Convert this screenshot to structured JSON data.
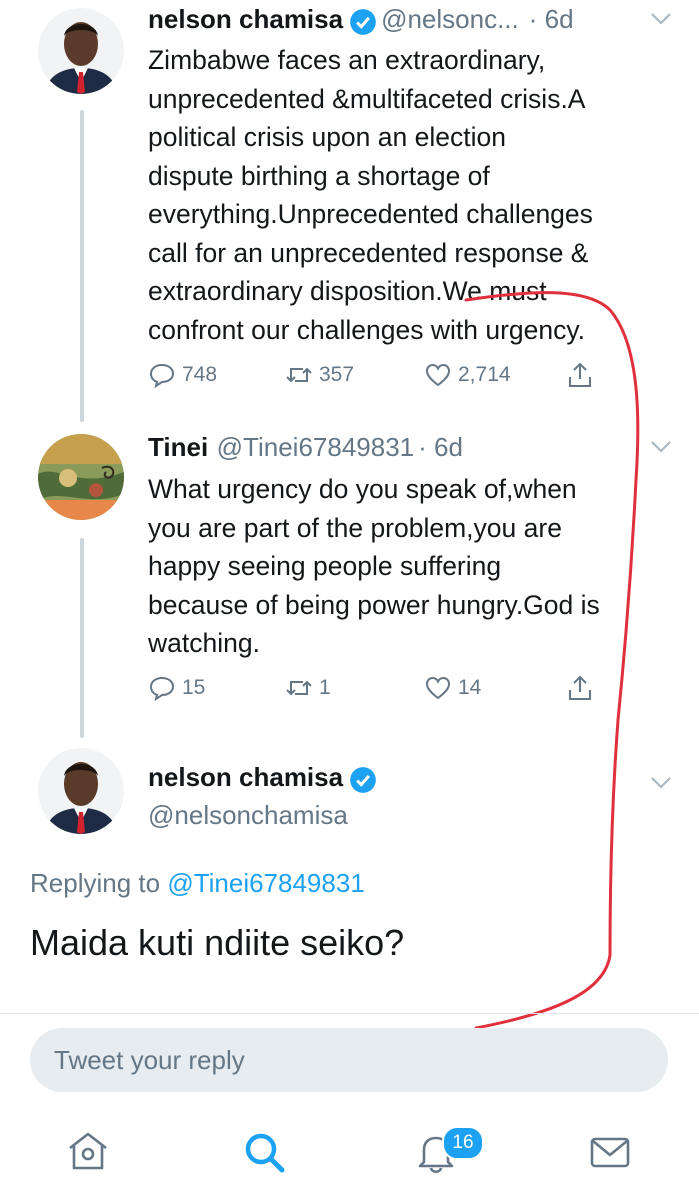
{
  "tweets": [
    {
      "name": "nelson chamisa",
      "handle": "@nelsonc...",
      "time": "· 6d",
      "text_lines": [
        "Zimbabwe faces an extraordinary,",
        "unprecedented &multifaceted crisis.A",
        "political crisis upon an election",
        "dispute birthing a shortage of",
        "everything.Unprecedented challenges",
        "call for an unprecedented response &",
        "extraordinary disposition.We must",
        "confront our challenges with urgency."
      ],
      "replies": "748",
      "retweets": "357",
      "likes": "2,714"
    },
    {
      "name": "Tinei",
      "handle": "@Tinei67849831",
      "time": "· 6d",
      "text_lines": [
        "What urgency do you speak of,when",
        "you are part of the problem,you are",
        "happy seeing people suffering",
        "because of being power hungry.God is",
        "watching."
      ],
      "replies": "15",
      "retweets": "1",
      "likes": "14"
    }
  ],
  "focused": {
    "name": "nelson chamisa",
    "handle": "@nelsonchamisa",
    "replying_prefix": "Replying to",
    "replying_handle": "@Tinei67849831",
    "text": "Maida kuti ndiite seiko?"
  },
  "reply_box": {
    "placeholder": "Tweet your reply"
  },
  "tabbar": {
    "notifications_badge": "16"
  },
  "colors": {
    "accent": "#1da1f2",
    "muted": "#657786",
    "annotation": "#e0303c"
  }
}
